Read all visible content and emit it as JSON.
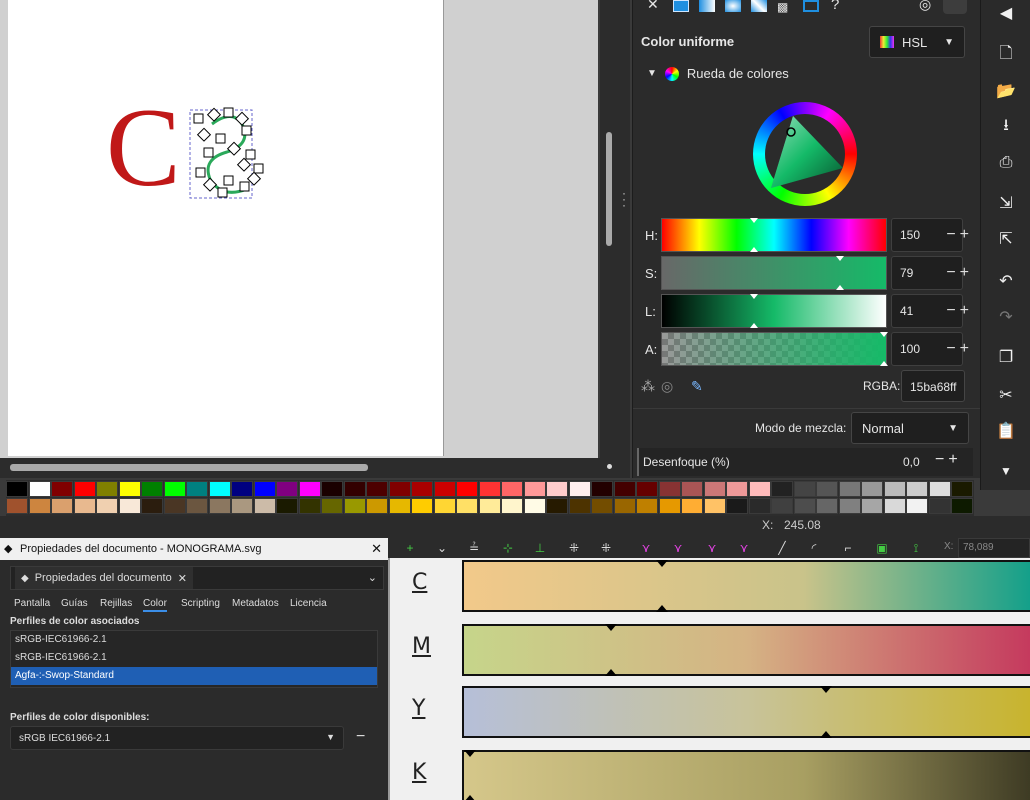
{
  "color_panel": {
    "title": "Color uniforme",
    "mode": "HSL",
    "wheel_label": "Rueda de colores",
    "sliders": [
      {
        "label": "H:",
        "value": "150",
        "level_pct": 41
      },
      {
        "label": "S:",
        "value": "79",
        "level_pct": 79
      },
      {
        "label": "L:",
        "value": "41",
        "level_pct": 41
      },
      {
        "label": "A:",
        "value": "100",
        "level_pct": 100
      }
    ],
    "rgba_label": "RGBA:",
    "rgba_value": "15ba68ff",
    "blend_label": "Modo de mezcla:",
    "blend_value": "Normal",
    "blur_label": "Desenfoque (%)",
    "blur_value": "0,0",
    "accent": "#15ba68"
  },
  "status": {
    "x_label": "X:",
    "x_value": "245.08",
    "x2_label": "X:",
    "x2_value": "78,089"
  },
  "doc_props": {
    "window_title": "Propiedades del documento - MONOGRAMA.svg",
    "tab_title": "Propiedades del documento",
    "tabs": [
      "Pantalla",
      "Guías",
      "Rejillas",
      "Color",
      "Scripting",
      "Metadatos",
      "Licencia"
    ],
    "active_tab": "Color",
    "linked_heading": "Perfiles de color asociados",
    "linked_profiles": [
      "sRGB-IEC61966-2.1",
      "sRGB-IEC61966-2.1",
      "Agfa-:-Swop-Standard"
    ],
    "available_heading": "Perfiles de color disponibles:",
    "available_value": "sRGB IEC61966-2.1"
  },
  "cmyk": {
    "channels": [
      {
        "letter": "C",
        "level_pct": 35
      },
      {
        "letter": "M",
        "level_pct": 26
      },
      {
        "letter": "Y",
        "level_pct": 64
      },
      {
        "letter": "K",
        "level_pct": 1
      }
    ]
  },
  "canvas": {
    "monogram_letter": "C",
    "monogram_color": "#c01818"
  }
}
